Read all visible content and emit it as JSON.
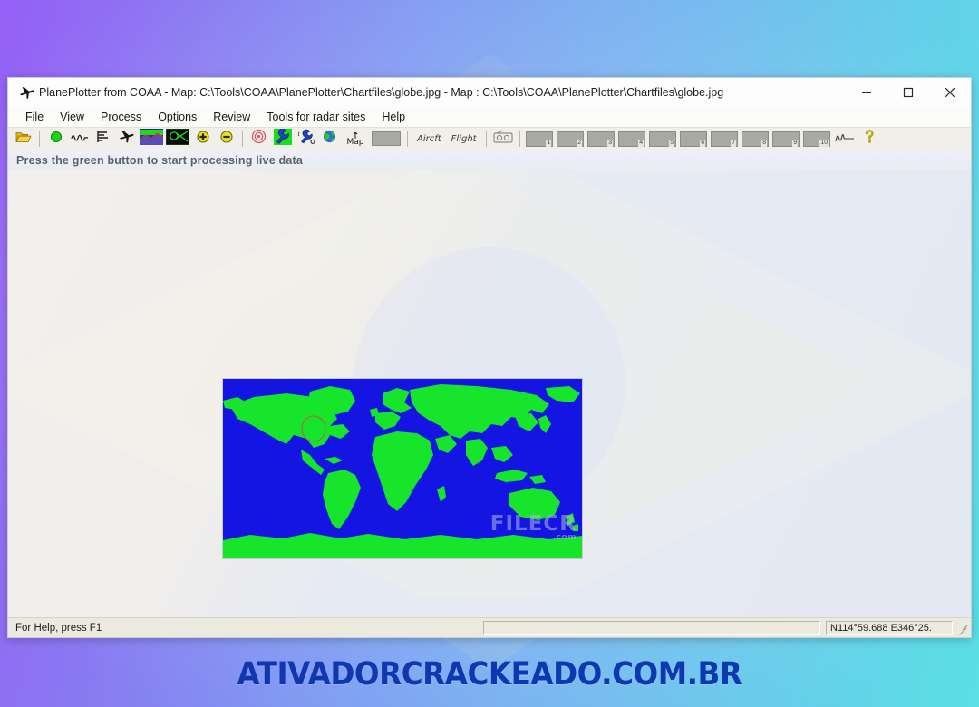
{
  "desktop": {
    "footer_banner": "ATIVADORCRACKEADO.COM.BR",
    "wallpaper_description": "brazil-flag-watercolor",
    "gradient_from": "#8b4ff5",
    "gradient_to": "#49dde3",
    "banner_color": "#0f37b0"
  },
  "window": {
    "title": "PlanePlotter from COAA - Map: C:\\Tools\\COAA\\PlanePlotter\\Chartfiles\\globe.jpg - Map : C:\\Tools\\COAA\\PlanePlotter\\Chartfiles\\globe.jpg",
    "app_icon": "airplane-icon",
    "controls": {
      "minimize": "minimize-icon",
      "maximize": "maximize-icon",
      "close": "close-icon"
    }
  },
  "menubar": {
    "items": [
      {
        "label": "File"
      },
      {
        "label": "View"
      },
      {
        "label": "Process"
      },
      {
        "label": "Options"
      },
      {
        "label": "Review"
      },
      {
        "label": "Tools for radar sites"
      },
      {
        "label": "Help"
      }
    ]
  },
  "toolbar": {
    "buttons": [
      {
        "name": "open-file-icon",
        "type": "icon"
      },
      {
        "name": "start-processing-icon",
        "type": "icon"
      },
      {
        "name": "waveform-icon",
        "type": "icon"
      },
      {
        "name": "bar-levels-icon",
        "type": "icon"
      },
      {
        "name": "aircraft-icon",
        "type": "icon"
      },
      {
        "name": "chart-thumbnail-icon",
        "type": "icon"
      },
      {
        "name": "radar-plot-icon",
        "type": "icon"
      },
      {
        "name": "zoom-in-icon",
        "type": "icon"
      },
      {
        "name": "zoom-out-icon",
        "type": "icon"
      },
      {
        "name": "target-icon",
        "type": "icon"
      },
      {
        "name": "wrench-icon",
        "type": "icon"
      },
      {
        "name": "info-wrench-icon",
        "type": "icon"
      },
      {
        "name": "globe-icon",
        "type": "icon"
      },
      {
        "name": "map-icon",
        "type": "icon"
      }
    ],
    "text_buttons": [
      {
        "label": "Aircft"
      },
      {
        "label": "Flight"
      }
    ],
    "numbered_buttons": [
      "1",
      "2",
      "3",
      "4",
      "5",
      "6",
      "7",
      "8",
      "9",
      "10"
    ],
    "map_label": "Map",
    "trailing_icons": [
      {
        "name": "signature-trace-icon"
      },
      {
        "name": "help-question-icon"
      }
    ]
  },
  "hint": {
    "text": "Press the green button to start processing live data"
  },
  "map": {
    "ocean_color": "#1414e3",
    "land_color": "#17e52b",
    "watermark": "FILECR",
    "watermark_suffix": ".com",
    "marker": "red-circle-marker"
  },
  "statusbar": {
    "help_text": "For Help, press F1",
    "panel_text": "",
    "coordinates": "N114°59.688 E346°25."
  }
}
